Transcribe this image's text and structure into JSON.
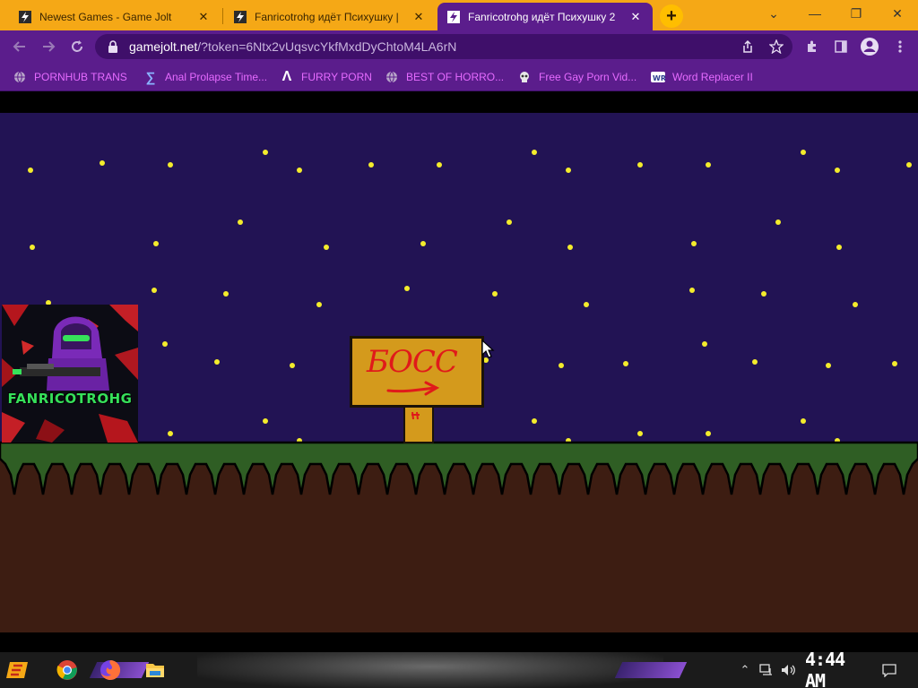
{
  "browser": {
    "tabs": [
      {
        "title": "Newest Games - Game Jolt",
        "active": false
      },
      {
        "title": "Fanricotrohg идёт Психушку |",
        "active": false
      },
      {
        "title": "Fanricotrohg идёт Психушку 2",
        "active": true
      }
    ],
    "new_tab_label": "+",
    "window_controls": {
      "dropdown": "⌄",
      "minimize": "—",
      "restore": "❐",
      "close": "✕"
    },
    "address_bar": {
      "host": "gamejolt.net",
      "path": "/?token=6Ntx2vUqsvcYkfMxdDyChtoM4LA6rN"
    },
    "bookmarks": [
      {
        "label": "PORNHUB TRANS",
        "icon": "globe-icon"
      },
      {
        "label": "Anal Prolapse Time...",
        "icon": "sigma-icon"
      },
      {
        "label": "FURRY PORN",
        "icon": "lambda-icon"
      },
      {
        "label": "BEST OF HORRO...",
        "icon": "globe-icon"
      },
      {
        "label": "Free Gay Porn Vid...",
        "icon": "skull-icon"
      },
      {
        "label": "Word Replacer II",
        "icon": "wr-icon"
      }
    ]
  },
  "game": {
    "avatar_name": "FANRICOTROHG",
    "sign_text": "БОСС",
    "colors": {
      "sky": "#221354",
      "star": "#f4ec2c",
      "grass": "#2f5e24",
      "dirt": "#3d1d12",
      "sign": "#d49a1c",
      "sign_text": "#e01a1a"
    }
  },
  "taskbar": {
    "clock": "4:44 AM",
    "apps": [
      "start-icon",
      "chrome-icon",
      "firefox-icon",
      "file-explorer-icon"
    ]
  },
  "theme": {
    "tabstrip": "#f5a816",
    "toolbar": "#5b1d8c",
    "bookmark_text": "#e66bff"
  }
}
